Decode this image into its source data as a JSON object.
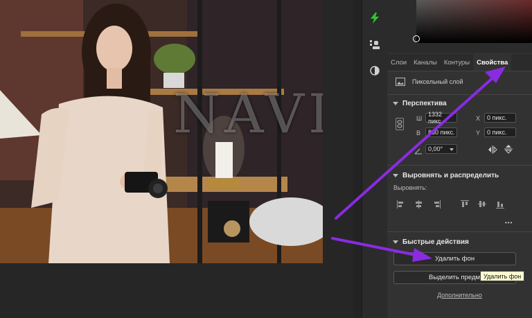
{
  "watermark": "NAVI",
  "panel_tabs": [
    {
      "label": "Слои",
      "active": false
    },
    {
      "label": "Каналы",
      "active": false
    },
    {
      "label": "Контуры",
      "active": false
    },
    {
      "label": "Свойства",
      "active": true
    }
  ],
  "layer": {
    "type_label": "Пиксельный слой",
    "icon": "pixel-layer-icon"
  },
  "perspective": {
    "title": "Перспектива",
    "w_label": "Ш",
    "w_value": "1332 пикс.",
    "h_label": "В",
    "h_value": "850 пикс.",
    "x_label": "X",
    "x_value": "0 пикс.",
    "y_label": "Y",
    "y_value": "0 пикс.",
    "angle_value": "0,00°"
  },
  "align": {
    "title": "Выровнять и распределить",
    "label": "Выровнять:",
    "more": "•••"
  },
  "quick_actions": {
    "title": "Быстрые действия",
    "remove_bg": "Удалить фон",
    "select_subject": "Выделить предмет",
    "more_link": "Дополнительно"
  },
  "tooltip": "Удалить фон",
  "colors": {
    "accent_arrow": "#8a2be2",
    "panel_bg": "#323232",
    "tool_accent": "#31c531"
  }
}
